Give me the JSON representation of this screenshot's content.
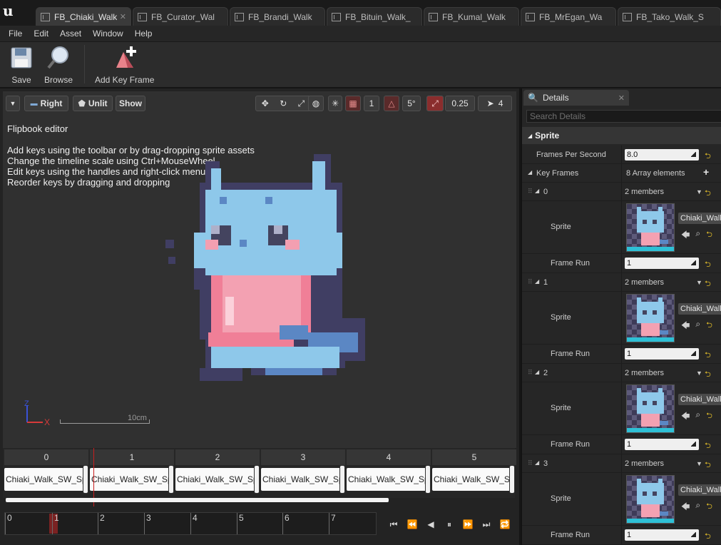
{
  "tabs": [
    {
      "label": "FB_Chiaki_Walk",
      "active": true
    },
    {
      "label": "FB_Curator_Wal",
      "active": false
    },
    {
      "label": "FB_Brandi_Walk",
      "active": false
    },
    {
      "label": "FB_Bituin_Walk_",
      "active": false
    },
    {
      "label": "FB_Kumal_Walk",
      "active": false
    },
    {
      "label": "FB_MrEgan_Wa",
      "active": false
    },
    {
      "label": "FB_Tako_Walk_S",
      "active": false
    }
  ],
  "menu": [
    "File",
    "Edit",
    "Asset",
    "Window",
    "Help"
  ],
  "toolbar": {
    "save_label": "Save",
    "browse_label": "Browse",
    "add_key_frame_label": "Add Key Frame"
  },
  "viewport": {
    "view_mode": "Right",
    "lighting": "Unlit",
    "show": "Show",
    "rotation_snap": "5°",
    "scale_snap": "0.25",
    "camera_speed": "4",
    "grid_value": "1",
    "help_text": "Flipbook editor\n\nAdd keys using the toolbar or by drag-dropping sprite assets\nChange the timeline scale using Ctrl+MouseWheel\nEdit keys using the handles and right-click menu\nReorder keys by dragging and dropping",
    "axis_z": "Z",
    "axis_x": "X",
    "scale_label": "10cm",
    "accent_color": "#c81e1e"
  },
  "timeline": {
    "frame_numbers": [
      "0",
      "1",
      "2",
      "3",
      "4",
      "5"
    ],
    "key_labels": [
      "Chiaki_Walk_SW_Spri",
      "Chiaki_Walk_SW_Spri",
      "Chiaki_Walk_SW_Spri",
      "Chiaki_Walk_SW_Spri",
      "Chiaki_Walk_SW_Spri",
      "Chiaki_Walk_SW_Spr"
    ],
    "scrub_ticks": [
      "0",
      "1",
      "2",
      "3",
      "4",
      "5",
      "6",
      "7"
    ],
    "current_frame": 1
  },
  "details": {
    "tab_title": "Details",
    "search_placeholder": "Search Details",
    "category": "Sprite",
    "fps_label": "Frames Per Second",
    "fps_value": "8.0",
    "key_frames_label": "Key Frames",
    "key_frames_count": "8 Array elements",
    "elements": [
      {
        "index": "0",
        "members": "2 members",
        "sprite_label": "Sprite",
        "asset": "Chiaki_Walk",
        "frame_run_label": "Frame Run",
        "frame_run": "1"
      },
      {
        "index": "1",
        "members": "2 members",
        "sprite_label": "Sprite",
        "asset": "Chiaki_Walk",
        "frame_run_label": "Frame Run",
        "frame_run": "1"
      },
      {
        "index": "2",
        "members": "2 members",
        "sprite_label": "Sprite",
        "asset": "Chiaki_Walk",
        "frame_run_label": "Frame Run",
        "frame_run": "1"
      },
      {
        "index": "3",
        "members": "2 members",
        "sprite_label": "Sprite",
        "asset": "Chiaki_Walk",
        "frame_run_label": "Frame Run",
        "frame_run": "1"
      }
    ],
    "reset_color": "#d7b52a"
  }
}
